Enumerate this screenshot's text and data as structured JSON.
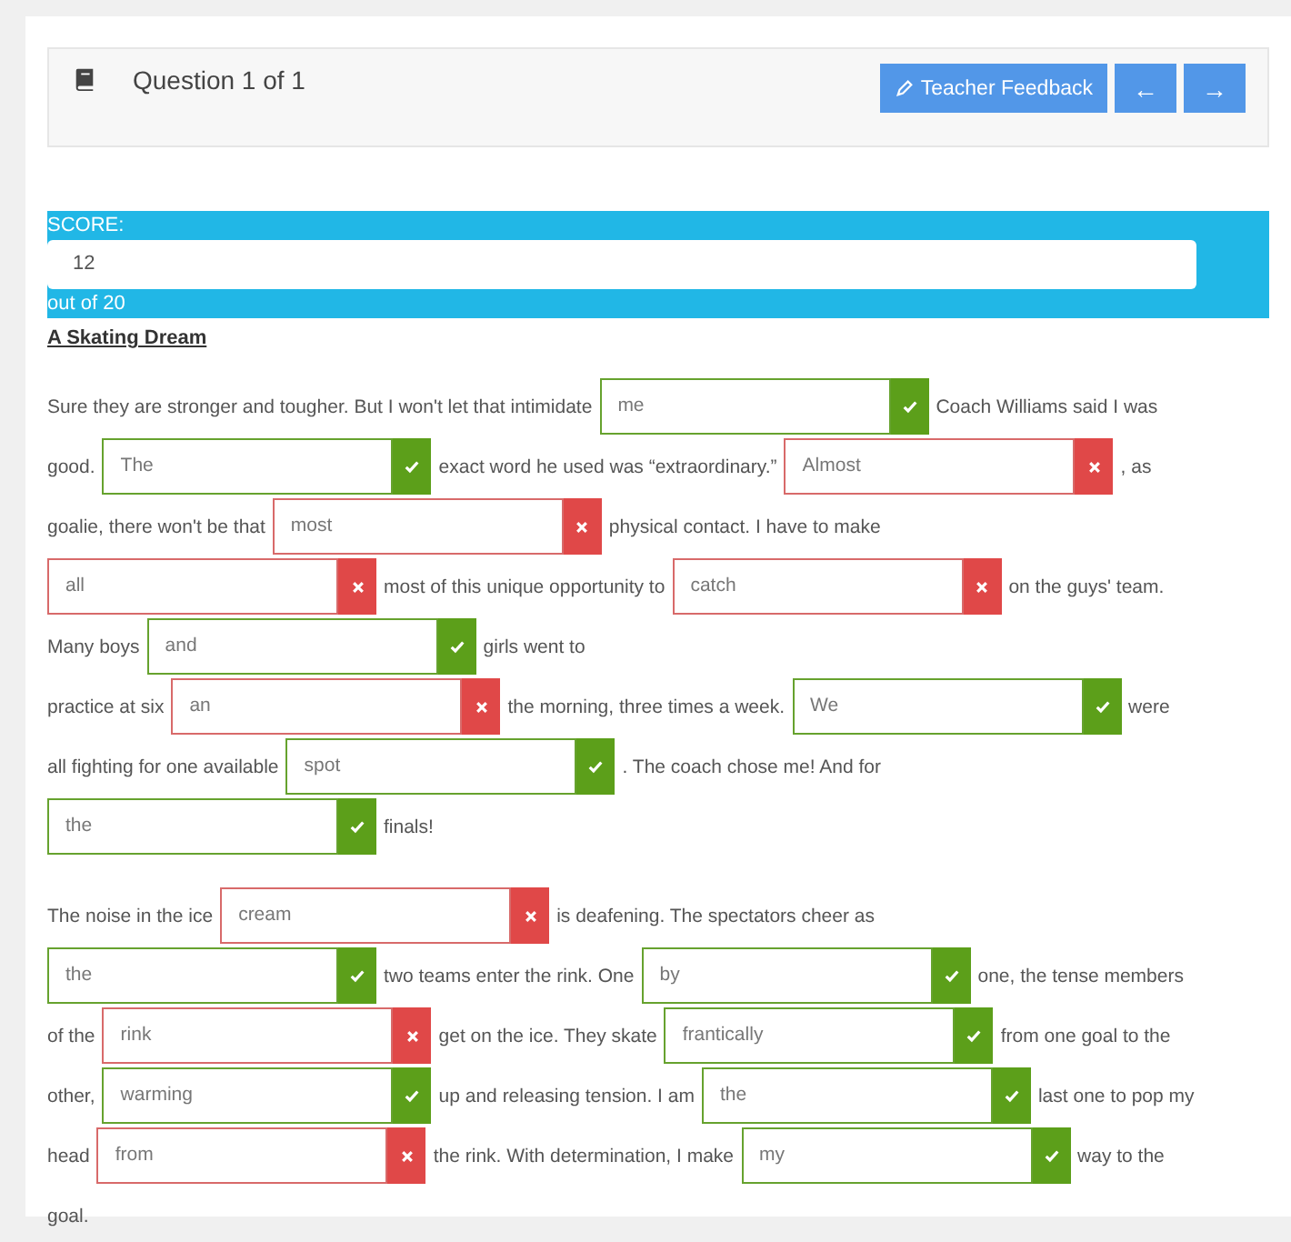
{
  "header": {
    "question": "Question 1 of 1",
    "feedback_button": "Teacher Feedback",
    "prev_button": "←",
    "next_button": "→"
  },
  "score": {
    "label": "SCORE:",
    "value": "12",
    "out_of": "out of 20"
  },
  "title": "A Skating Dream",
  "paragraphs": [
    [
      [
        {
          "kind": "text",
          "text": "Sure they are stronger and tougher. But I won't let that intimidate"
        },
        {
          "kind": "blank",
          "value": "me",
          "correct": true
        },
        {
          "kind": "text",
          "text": "Coach Williams said I was"
        }
      ],
      [
        {
          "kind": "text",
          "text": "good."
        },
        {
          "kind": "blank",
          "value": "The",
          "correct": true
        },
        {
          "kind": "text",
          "text": "exact word he used was “extraordinary.”"
        },
        {
          "kind": "blank",
          "value": "Almost",
          "correct": false
        },
        {
          "kind": "text",
          "text": ", as"
        }
      ],
      [
        {
          "kind": "text",
          "text": "goalie, there won't be that"
        },
        {
          "kind": "blank",
          "value": "most",
          "correct": false
        },
        {
          "kind": "text",
          "text": "physical contact. I have to make"
        }
      ],
      [
        {
          "kind": "blank",
          "value": "all",
          "correct": false
        },
        {
          "kind": "text",
          "text": "most of this unique opportunity to"
        },
        {
          "kind": "blank",
          "value": "catch",
          "correct": false
        },
        {
          "kind": "text",
          "text": "on the guys' team."
        }
      ],
      [
        {
          "kind": "text",
          "text": "Many boys"
        },
        {
          "kind": "blank",
          "value": "and",
          "correct": true
        },
        {
          "kind": "text",
          "text": "girls went to"
        }
      ],
      [
        {
          "kind": "text",
          "text": "practice at six"
        },
        {
          "kind": "blank",
          "value": "an",
          "correct": false
        },
        {
          "kind": "text",
          "text": "the morning, three times a week."
        },
        {
          "kind": "blank",
          "value": "We",
          "correct": true
        },
        {
          "kind": "text",
          "text": "were"
        }
      ],
      [
        {
          "kind": "text",
          "text": "all fighting for one available"
        },
        {
          "kind": "blank",
          "value": "spot",
          "correct": true
        },
        {
          "kind": "text",
          "text": ". The coach chose me! And for"
        }
      ],
      [
        {
          "kind": "blank",
          "value": "the",
          "correct": true
        },
        {
          "kind": "text",
          "text": "finals!"
        }
      ]
    ],
    [
      [
        {
          "kind": "text",
          "text": "The noise in the ice"
        },
        {
          "kind": "blank",
          "value": "cream",
          "correct": false
        },
        {
          "kind": "text",
          "text": "is deafening. The spectators cheer as"
        }
      ],
      [
        {
          "kind": "blank",
          "value": "the",
          "correct": true
        },
        {
          "kind": "text",
          "text": "two teams enter the rink. One"
        },
        {
          "kind": "blank",
          "value": "by",
          "correct": true
        },
        {
          "kind": "text",
          "text": "one, the tense members"
        }
      ],
      [
        {
          "kind": "text",
          "text": "of the"
        },
        {
          "kind": "blank",
          "value": "rink",
          "correct": false
        },
        {
          "kind": "text",
          "text": "get on the ice. They skate"
        },
        {
          "kind": "blank",
          "value": "frantically",
          "correct": true
        },
        {
          "kind": "text",
          "text": "from one goal to the"
        }
      ],
      [
        {
          "kind": "text",
          "text": "other,"
        },
        {
          "kind": "blank",
          "value": "warming",
          "correct": true
        },
        {
          "kind": "text",
          "text": "up and releasing tension. I am"
        },
        {
          "kind": "blank",
          "value": "the",
          "correct": true
        },
        {
          "kind": "text",
          "text": "last one to pop my"
        }
      ],
      [
        {
          "kind": "text",
          "text": "head"
        },
        {
          "kind": "blank",
          "value": "from",
          "correct": false
        },
        {
          "kind": "text",
          "text": "the rink. With determination, I make"
        },
        {
          "kind": "blank",
          "value": "my",
          "correct": true
        },
        {
          "kind": "text",
          "text": "way to the"
        }
      ],
      [
        {
          "kind": "text",
          "text": "goal."
        }
      ]
    ]
  ]
}
